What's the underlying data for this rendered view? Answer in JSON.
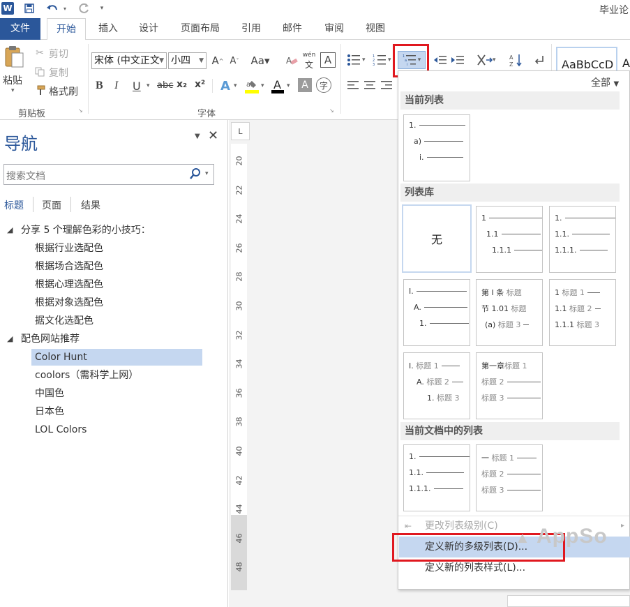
{
  "titlebar": {
    "app_icon": "W",
    "doc_title": "毕业论"
  },
  "tabs": [
    "文件",
    "开始",
    "插入",
    "设计",
    "页面布局",
    "引用",
    "邮件",
    "审阅",
    "视图"
  ],
  "clipboard": {
    "paste": "粘贴",
    "cut": "剪切",
    "copy": "复制",
    "format_painter": "格式刷",
    "label": "剪贴板"
  },
  "font": {
    "name": "宋体 (中文正文",
    "size": "小四",
    "label": "字体",
    "bold": "B",
    "italic": "I",
    "underline": "U",
    "strike": "abc",
    "subscript": "x₂",
    "superscript": "x²"
  },
  "styles": {
    "preview": "AaBbCcD",
    "preview2": "A",
    "all_label": "全部"
  },
  "navigation": {
    "title": "导航",
    "search_placeholder": "搜索文档",
    "tabs": [
      "标题",
      "页面",
      "结果"
    ],
    "tree": [
      {
        "label": "分享 5 个理解色彩的小技巧：",
        "level": 1,
        "expanded": true
      },
      {
        "label": "根据行业选配色",
        "level": 2
      },
      {
        "label": "根据场合选配色",
        "level": 2
      },
      {
        "label": "根据心理选配色",
        "level": 2
      },
      {
        "label": "根据对象选配色",
        "level": 2
      },
      {
        "label": "据文化选配色",
        "level": 2
      },
      {
        "label": "配色网站推荐",
        "level": 1,
        "expanded": true
      },
      {
        "label": "Color Hunt",
        "level": 2,
        "selected": true
      },
      {
        "label": "coolors（需科学上网）",
        "level": 2
      },
      {
        "label": "中国色",
        "level": 2
      },
      {
        "label": "日本色",
        "level": 2
      },
      {
        "label": "LOL Colors",
        "level": 2
      }
    ]
  },
  "ruler": {
    "corner": "L",
    "numbers": [
      "20",
      "22",
      "24",
      "26",
      "28",
      "30",
      "32",
      "34",
      "36",
      "38",
      "40",
      "42",
      "44",
      "46",
      "48"
    ]
  },
  "multilevel_menu": {
    "section_current": "当前列表",
    "section_library": "列表库",
    "section_in_doc": "当前文档中的列表",
    "none_label": "无",
    "current_tile": [
      "1.",
      "a)",
      "i."
    ],
    "lib_tiles": [
      {
        "lines": [
          "1",
          "1.1",
          "1.1.1"
        ]
      },
      {
        "lines": [
          "1.",
          "1.1.",
          "1.1.1."
        ]
      },
      {
        "lines": [
          "I.",
          "A.",
          "1."
        ]
      },
      {
        "lines": [
          "第 I 条",
          "节 1.01",
          "(a)"
        ],
        "caps": [
          "标题",
          "标题",
          "标题 3"
        ]
      },
      {
        "lines": [
          "1",
          "1.1",
          "1.1.1"
        ],
        "caps": [
          "标题 1",
          "标题 2",
          "标题 3"
        ]
      },
      {
        "lines": [
          "I.",
          "A.",
          "1."
        ],
        "caps": [
          "标题 1",
          "标题 2",
          "标题 3"
        ]
      },
      {
        "lines": [
          "第一章",
          "",
          ""
        ],
        "caps": [
          "标题 1",
          "标题 2",
          "标题 3"
        ]
      }
    ],
    "doc_tiles": [
      {
        "lines": [
          "1.",
          "1.1.",
          "1.1.1."
        ]
      },
      {
        "lines": [
          "一",
          "",
          ""
        ],
        "caps": [
          "标题 1",
          "标题 2",
          "标题 3"
        ]
      }
    ],
    "change_level": "更改列表级别(C)",
    "define_multilevel": "定义新的多级列表(D)...",
    "define_style": "定义新的列表样式(L)..."
  },
  "watermark": "AppSo",
  "colors": {
    "accent": "#2b579a",
    "highlight_red": "#e0181f",
    "selection": "#c5d7f0"
  }
}
